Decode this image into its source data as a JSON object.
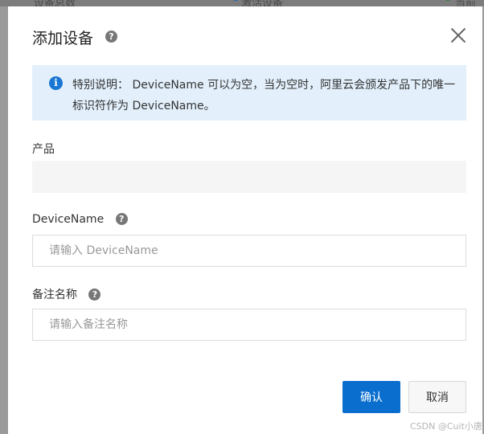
{
  "background": {
    "col1": "设备总数",
    "col2": "激活设备",
    "col3": "当前",
    "dot_blue": "#1565c0",
    "dot_green": "#2e7d32"
  },
  "dialog": {
    "title": "添加设备",
    "title_help_icon": "question-circle-icon",
    "close_icon": "close-icon",
    "notice": {
      "icon": "info-circle-icon",
      "text": "特别说明： DeviceName 可以为空，当为空时，阿里云会颁发产品下的唯一标识符作为 DeviceName。"
    },
    "fields": {
      "product": {
        "label": "产品",
        "value": ""
      },
      "device_name": {
        "label": "DeviceName",
        "placeholder": "请输入 DeviceName",
        "value": ""
      },
      "remark": {
        "label": "备注名称",
        "placeholder": "请输入备注名称",
        "value": ""
      }
    },
    "buttons": {
      "confirm": "确认",
      "cancel": "取消"
    },
    "colors": {
      "primary": "#0a6ecf",
      "notice_bg": "#e3f0fc"
    }
  },
  "watermark": "CSDN @Cuit小唐"
}
